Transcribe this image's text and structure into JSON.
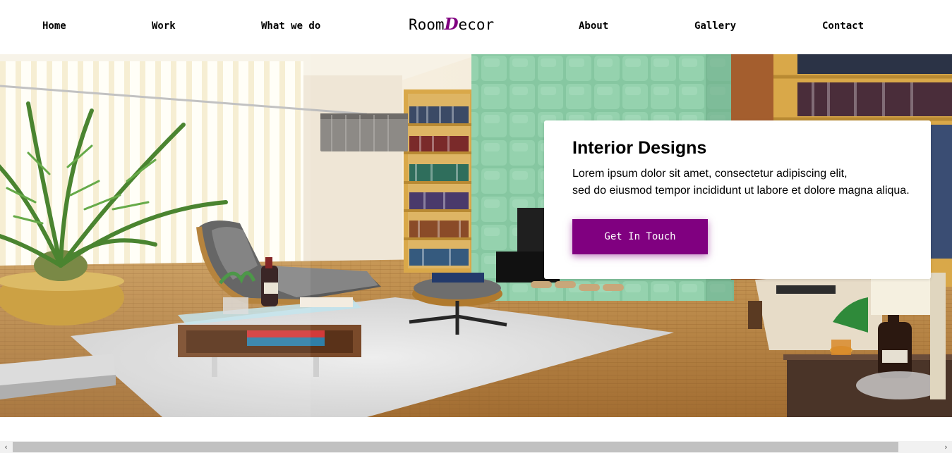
{
  "nav": {
    "items": [
      {
        "label": "Home"
      },
      {
        "label": "Work"
      },
      {
        "label": "What we do"
      },
      {
        "label": "About"
      },
      {
        "label": "Gallery"
      },
      {
        "label": "Contact"
      }
    ],
    "logo": {
      "prefix": "Room",
      "accent": "D",
      "suffix": "ecor"
    }
  },
  "hero": {
    "card": {
      "title": "Interior Designs",
      "line1": "Lorem ipsum dolor sit amet, consectetur adipiscing elit,",
      "line2": "sed do eiusmod tempor incididunt ut labore et dolore magna aliqua.",
      "button_label": "Get In Touch"
    },
    "image_alt": "living-room-interior-photo"
  },
  "scrollbar": {
    "left_icon": "chevron-left-icon",
    "right_icon": "chevron-right-icon",
    "left_glyph": "‹",
    "right_glyph": "›"
  },
  "colors": {
    "accent": "#800080",
    "background": "#ffffff"
  }
}
